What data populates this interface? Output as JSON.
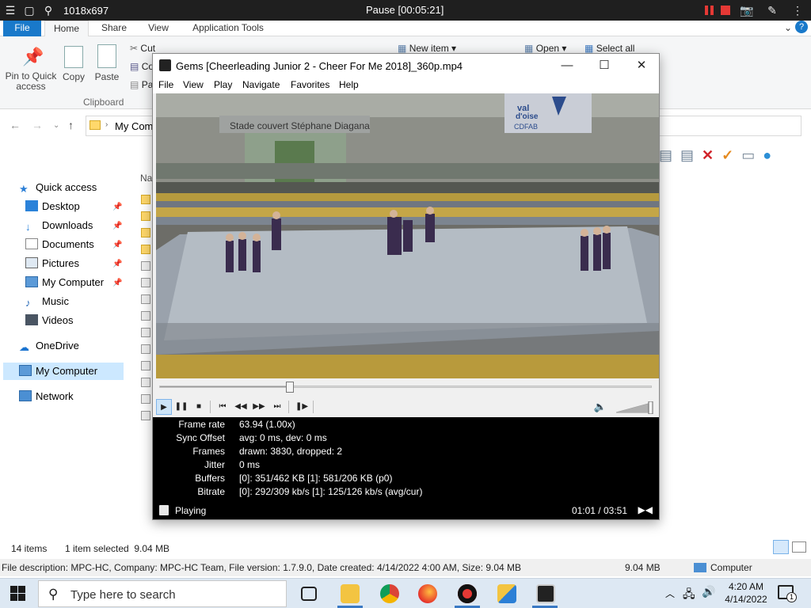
{
  "recorder": {
    "dims": "1018x697",
    "status": "Pause [00:05:21]"
  },
  "ribbon": {
    "tabs": [
      "File",
      "Home",
      "Share",
      "View",
      "Application Tools"
    ],
    "pin_label": "Pin to Quick access",
    "copy_label": "Copy",
    "paste_label": "Paste",
    "cut_label": "Cut",
    "co_label": "Co",
    "pa_label": "Pa",
    "clipboard_group": "Clipboard",
    "new_item": "New item",
    "open": "Open",
    "select_all": "Select all",
    "help": "?"
  },
  "address": {
    "path": "My Comp"
  },
  "nav": {
    "items": [
      {
        "label": "Quick access"
      },
      {
        "label": "Desktop"
      },
      {
        "label": "Downloads"
      },
      {
        "label": "Documents"
      },
      {
        "label": "Pictures"
      },
      {
        "label": "My Computer"
      },
      {
        "label": "Music"
      },
      {
        "label": "Videos"
      },
      {
        "label": "OneDrive"
      },
      {
        "label": "My Computer"
      },
      {
        "label": "Network"
      }
    ]
  },
  "filelist": {
    "header_partial": "Na"
  },
  "status": {
    "items": "14 items",
    "selected": "1 item selected  9.04 MB"
  },
  "details": {
    "description": "File description: MPC-HC, Company: MPC-HC Team, File version: 1.7.9.0, Date created: 4/14/2022 4:00 AM, Size: 9.04 MB",
    "size": "9.04 MB",
    "computer": "Computer"
  },
  "mpc": {
    "title": "Gems  [Cheerleading Junior 2 - Cheer For Me 2018]_360p.mp4",
    "menu": [
      "File",
      "View",
      "Play",
      "Navigate",
      "Favorites",
      "Help"
    ],
    "seek_progress": 0.265,
    "volume_level": 1.0,
    "video": {
      "banner": "Stade couvert Stéphane Diagana",
      "sign_line1": "val",
      "sign_line2": "d'oise",
      "sign_line3": "CDFAB"
    },
    "stats": [
      {
        "k": "Frame rate",
        "v": "63.94 (1.00x)"
      },
      {
        "k": "Sync Offset",
        "v": "avg: 0 ms, dev: 0 ms"
      },
      {
        "k": "Frames",
        "v": "drawn: 3830, dropped: 2"
      },
      {
        "k": "Jitter",
        "v": "0 ms"
      },
      {
        "k": "Buffers",
        "v": "[0]: 351/462 KB [1]: 581/206 KB (p0)"
      },
      {
        "k": "Bitrate",
        "v": "[0]: 292/309 kb/s [1]: 125/126 kb/s (avg/cur)"
      }
    ],
    "state": "Playing",
    "time": "01:01 / 03:51"
  },
  "taskbar": {
    "search_placeholder": "Type here to search",
    "time": "4:20 AM",
    "date": "4/14/2022",
    "notif_count": "1"
  }
}
